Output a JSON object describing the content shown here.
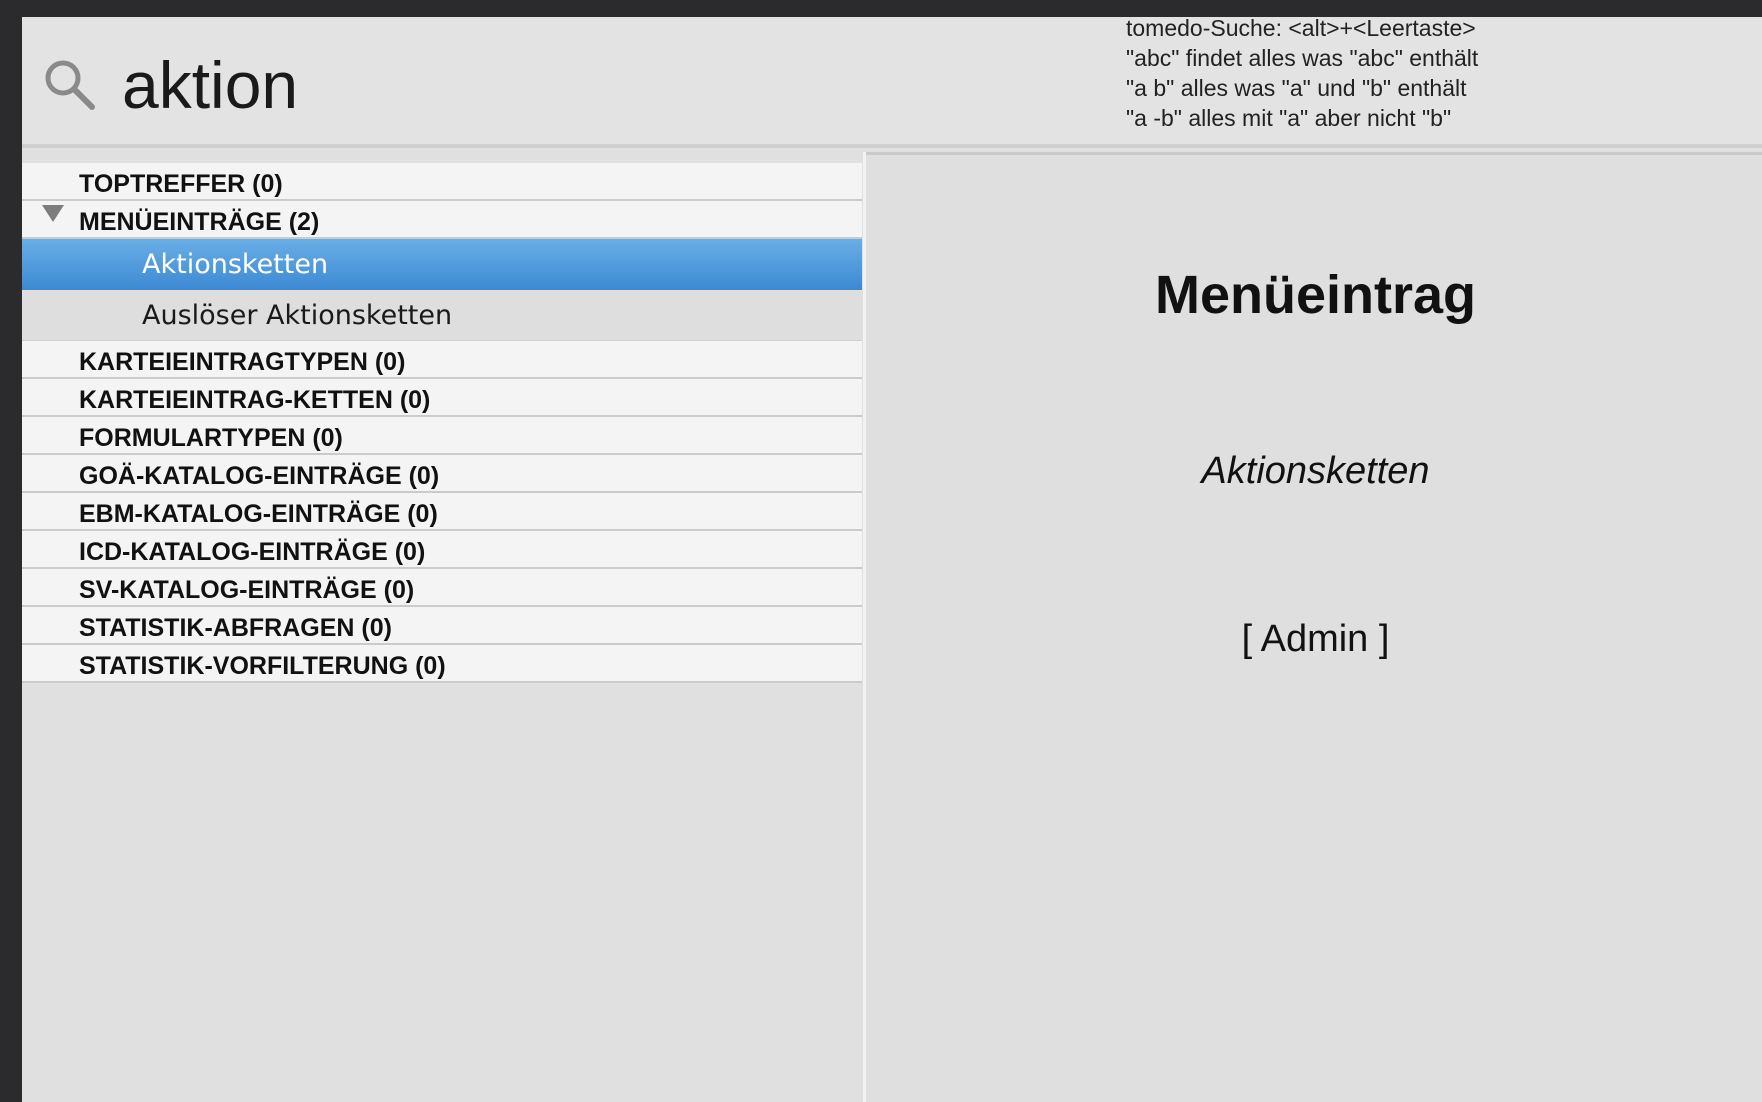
{
  "search": {
    "query": "aktion",
    "help_lines": [
      "tomedo-Suche: <alt>+<Leertaste>",
      "\"abc\" findet alles was \"abc\" enthält",
      "\"a b\" alles was \"a\" und \"b\" enthält",
      "\"a -b\" alles mit \"a\" aber nicht \"b\""
    ]
  },
  "results": {
    "categories": [
      {
        "label": "TOPTREFFER (0)"
      },
      {
        "label": "MENÜEINTRÄGE (2)",
        "expanded": true,
        "items": [
          {
            "label": "Aktionsketten",
            "selected": true
          },
          {
            "label": "Auslöser Aktionsketten",
            "selected": false
          }
        ]
      },
      {
        "label": "KARTEIEINTRAGTYPEN (0)"
      },
      {
        "label": "KARTEIEINTRAG-KETTEN (0)"
      },
      {
        "label": "FORMULARTYPEN (0)"
      },
      {
        "label": "GOÄ-KATALOG-EINTRÄGE (0)"
      },
      {
        "label": "EBM-KATALOG-EINTRÄGE (0)"
      },
      {
        "label": "ICD-KATALOG-EINTRÄGE (0)"
      },
      {
        "label": "SV-KATALOG-EINTRÄGE (0)"
      },
      {
        "label": "STATISTIK-ABFRAGEN (0)"
      },
      {
        "label": "STATISTIK-VORFILTERUNG (0)"
      }
    ]
  },
  "detail": {
    "title": "Menüeintrag",
    "name": "Aktionsketten",
    "role": "[ Admin ]"
  },
  "colors": {
    "selection": "#4a95db",
    "window_frame": "#2b2b2d"
  },
  "icons": {
    "search": "search-icon",
    "disclosure": "disclosure-triangle-icon"
  }
}
